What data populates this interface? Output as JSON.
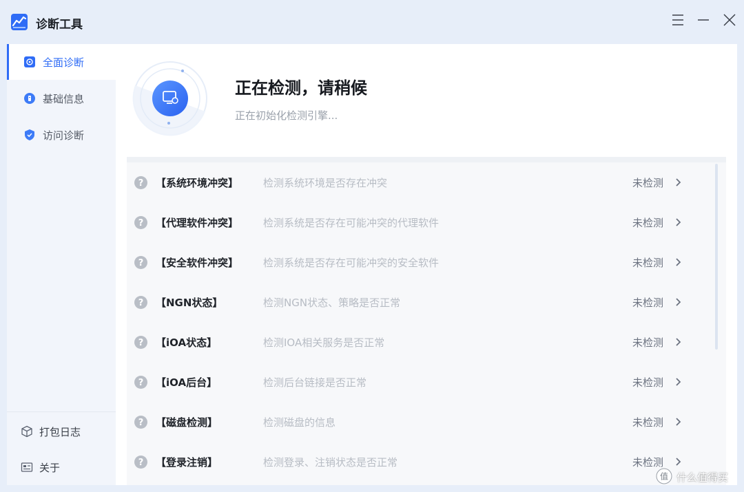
{
  "app": {
    "title": "诊断工具",
    "brand_color": "#2f6cf6"
  },
  "window_controls": {
    "menu_icon": "hamburger-icon",
    "minimize_icon": "minimize-icon",
    "close_icon": "close-icon"
  },
  "sidebar": {
    "items": [
      {
        "label": "全面诊断",
        "icon": "scan-icon",
        "active": true
      },
      {
        "label": "基础信息",
        "icon": "info-icon",
        "active": false
      },
      {
        "label": "访问诊断",
        "icon": "shield-icon",
        "active": false
      }
    ],
    "bottom_items": [
      {
        "label": "打包日志",
        "icon": "package-icon"
      },
      {
        "label": "关于",
        "icon": "about-icon"
      }
    ]
  },
  "main": {
    "title": "正在检测，请稍候",
    "subtitle": "正在初始化检测引擎..."
  },
  "checks": [
    {
      "name": "【系统环境冲突】",
      "desc": "检测系统环境是否存在冲突",
      "status": "未检测"
    },
    {
      "name": "【代理软件冲突】",
      "desc": "检测系统是否存在可能冲突的代理软件",
      "status": "未检测"
    },
    {
      "name": "【安全软件冲突】",
      "desc": "检测系统是否存在可能冲突的安全软件",
      "status": "未检测"
    },
    {
      "name": "【NGN状态】",
      "desc": "检测NGN状态、策略是否正常",
      "status": "未检测"
    },
    {
      "name": "【iOA状态】",
      "desc": "检测IOA相关服务是否正常",
      "status": "未检测"
    },
    {
      "name": "【iOA后台】",
      "desc": "检测后台链接是否正常",
      "status": "未检测"
    },
    {
      "name": "【磁盘检测】",
      "desc": "检测磁盘的信息",
      "status": "未检测"
    },
    {
      "name": "【登录注销】",
      "desc": "检测登录、注销状态是否正常",
      "status": "未检测"
    }
  ],
  "watermark": {
    "text": "什么值得买",
    "badge_text": "值"
  }
}
